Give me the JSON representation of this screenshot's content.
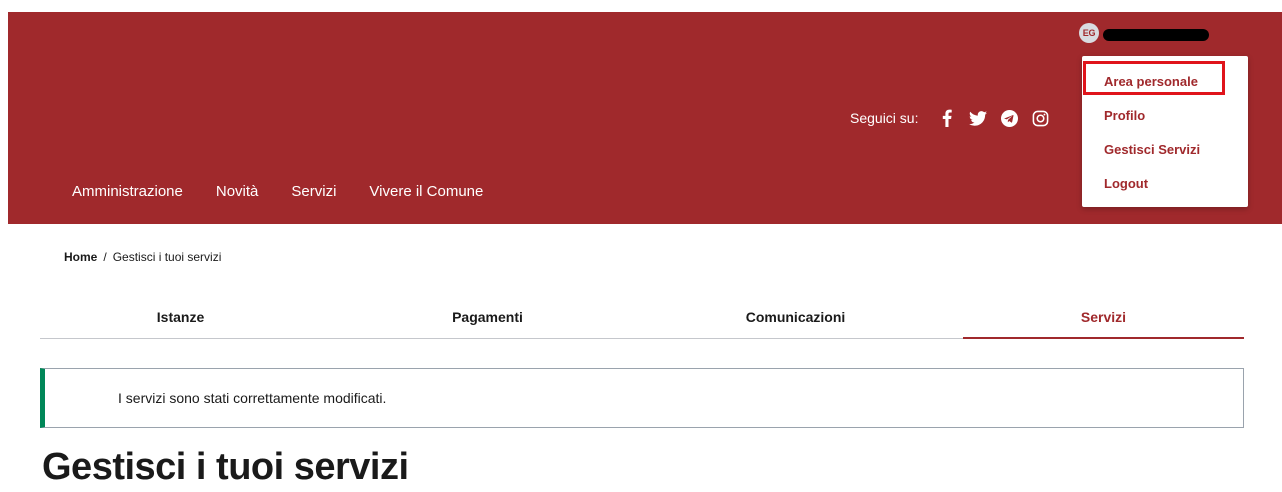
{
  "header": {
    "user": {
      "initials": "EG"
    },
    "social": {
      "label": "Seguici su:",
      "icons": [
        "facebook-icon",
        "twitter-icon",
        "telegram-icon",
        "instagram-icon"
      ]
    },
    "nav": [
      "Amministrazione",
      "Novità",
      "Servizi",
      "Vivere il Comune"
    ],
    "user_menu": [
      "Area personale",
      "Profilo",
      "Gestisci Servizi",
      "Logout"
    ],
    "colors": {
      "brand": "#a0292c",
      "highlight": "#e0141b"
    }
  },
  "breadcrumb": {
    "home": "Home",
    "separator": "/",
    "current": "Gestisci i tuoi servizi"
  },
  "tabs": [
    {
      "label": "Istanze",
      "active": false
    },
    {
      "label": "Pagamenti",
      "active": false
    },
    {
      "label": "Comunicazioni",
      "active": false
    },
    {
      "label": "Servizi",
      "active": true
    }
  ],
  "alert": {
    "message": "I servizi sono stati correttamente modificati.",
    "color": "#008758"
  },
  "page_title": "Gestisci i tuoi servizi"
}
